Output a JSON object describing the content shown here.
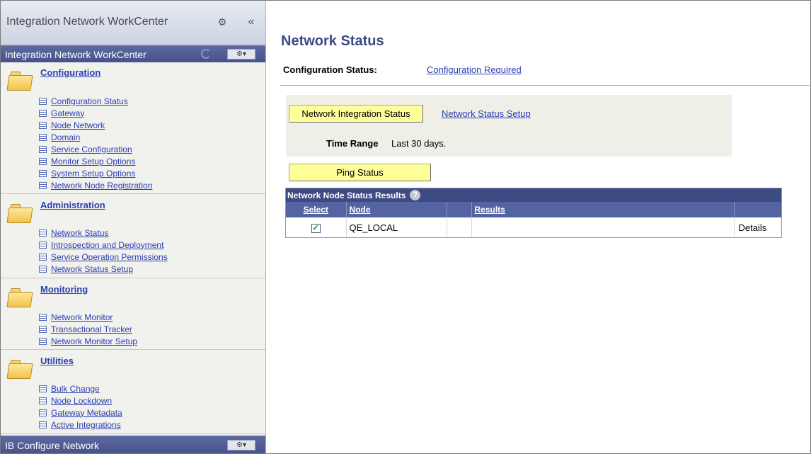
{
  "sidebar": {
    "app_title": "Integration Network WorkCenter",
    "gear_glyph": "⚙",
    "collapse_glyph": "«",
    "pagelet_title": "Integration Network WorkCenter",
    "menu_glyph": "⚙▾",
    "sections": [
      {
        "title": "Configuration",
        "links": [
          "Configuration Status",
          "Gateway",
          "Node Network",
          "Domain",
          "Service Configuration",
          "Monitor Setup Options",
          "System Setup Options",
          "Network Node Registration"
        ]
      },
      {
        "title": "Administration",
        "links": [
          "Network Status",
          "Introspection and Deployment",
          "Service Operation Permissions",
          "Network Status Setup"
        ]
      },
      {
        "title": "Monitoring",
        "links": [
          "Network Monitor",
          "Transactional Tracker",
          "Network Monitor Setup"
        ]
      },
      {
        "title": "Utilities",
        "links": [
          "Bulk Change",
          "Node Lockdown",
          "Gateway Metadata",
          "Active Integrations"
        ]
      }
    ],
    "bottom_pagelet_title": "IB Configure Network"
  },
  "main": {
    "page_title": "Network Status",
    "config_status_label": "Configuration Status:",
    "config_status_value": "Configuration Required",
    "network_integration_status_button": "Network Integration Status",
    "network_status_setup_link": "Network Status Setup",
    "time_range_label": "Time Range",
    "time_range_value": "Last 30 days.",
    "ping_status_button": "Ping Status",
    "grid": {
      "title": "Network Node Status Results",
      "help_glyph": "?",
      "columns": [
        "Select",
        "Node",
        "",
        "Results",
        ""
      ],
      "rows": [
        {
          "selected": true,
          "node": "QE_LOCAL",
          "extra": "",
          "results": "",
          "action": "Details"
        }
      ],
      "check_glyph": "✓"
    }
  }
}
